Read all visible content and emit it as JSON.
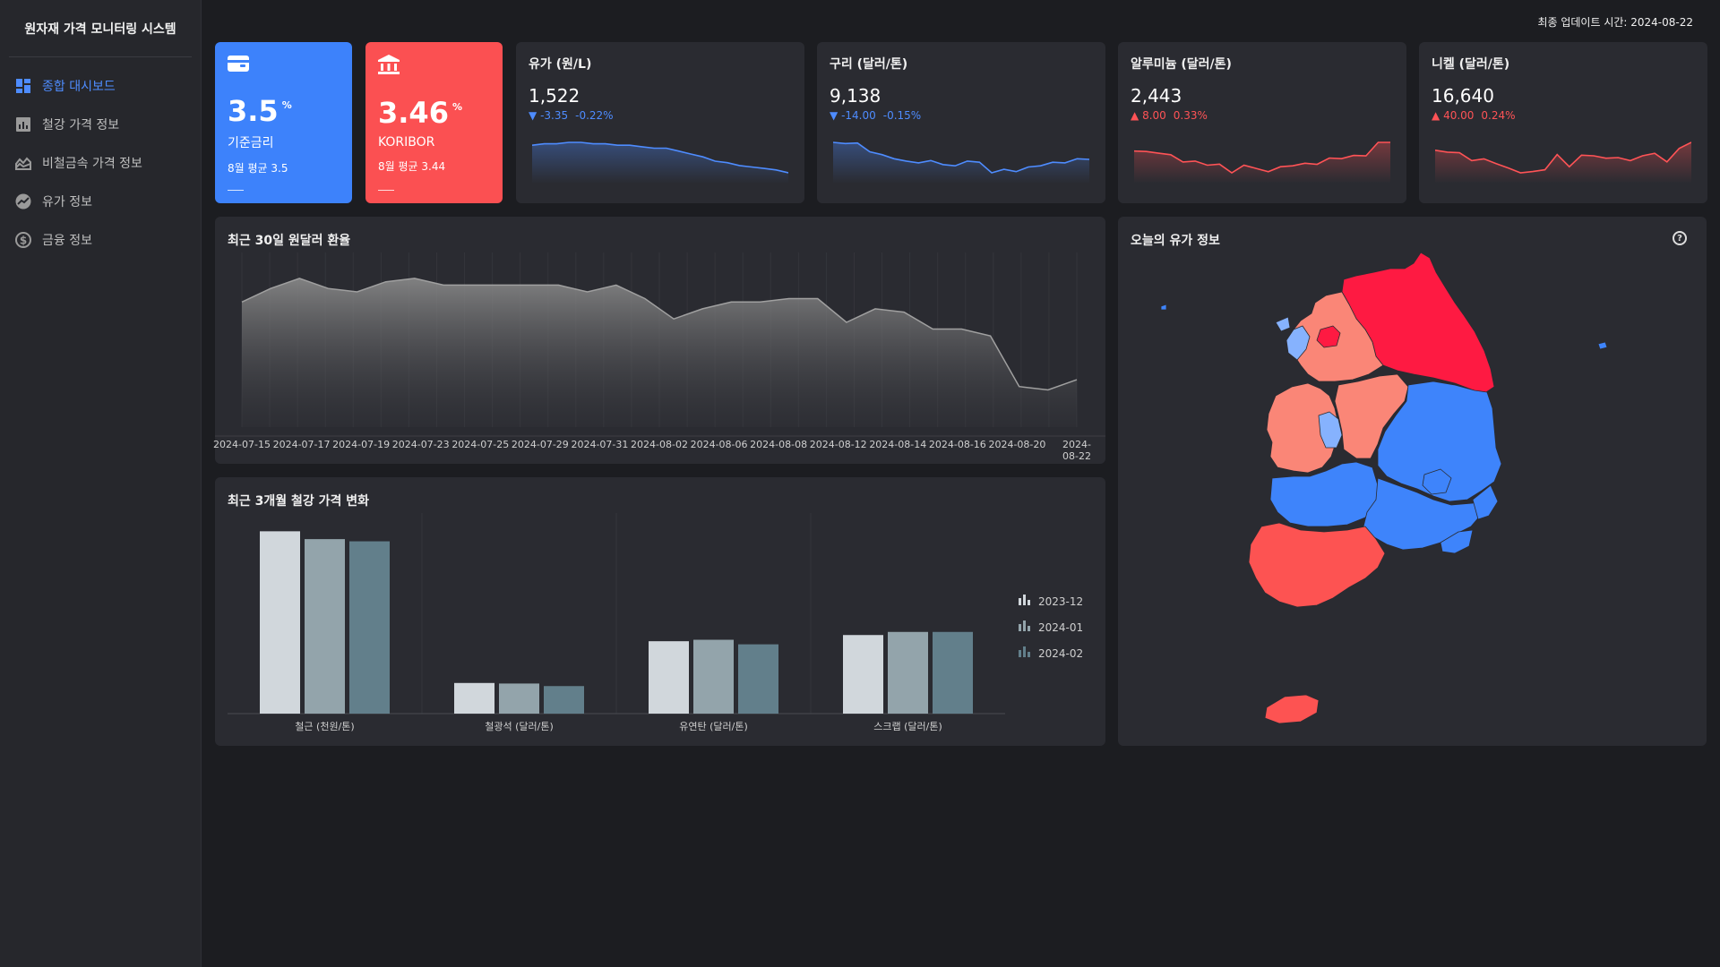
{
  "app": {
    "title": "원자재 가격 모니터링 시스템"
  },
  "sidebar": {
    "items": [
      {
        "label": "종합 대시보드",
        "icon": "dashboard-icon"
      },
      {
        "label": "철강 가격 정보",
        "icon": "bar-chart-icon"
      },
      {
        "label": "비철금속 가격 정보",
        "icon": "area-chart-icon"
      },
      {
        "label": "유가 정보",
        "icon": "trend-icon"
      },
      {
        "label": "금융 정보",
        "icon": "finance-icon"
      }
    ]
  },
  "header": {
    "updated": "최종 업데이트 시간: 2024-08-22"
  },
  "kpis": {
    "base_rate": {
      "value": "3.5",
      "unit": "%",
      "label": "기준금리",
      "avg": "8월 평균 3.5",
      "color": "#3d82fb"
    },
    "koribor": {
      "value": "3.46",
      "unit": "%",
      "label": "KORIBOR",
      "avg": "8월 평균 3.44",
      "color": "#fb5052"
    }
  },
  "minis": [
    {
      "title": "유가 (원/L)",
      "value": "1,522",
      "change": "-3.35",
      "pct": "-0.22%",
      "dir": "down",
      "series": [
        1538,
        1539,
        1539,
        1540,
        1540,
        1539,
        1539,
        1538,
        1538,
        1537,
        1536,
        1536,
        1534,
        1532,
        1530,
        1527,
        1526,
        1524,
        1523,
        1522,
        1521,
        1519
      ]
    },
    {
      "title": "구리 (달러/톤)",
      "value": "9,138",
      "change": "-14.00",
      "pct": "-0.15%",
      "dir": "down",
      "series": [
        9320,
        9310,
        9315,
        9240,
        9215,
        9180,
        9160,
        9145,
        9165,
        9130,
        9120,
        9160,
        9150,
        9060,
        9090,
        9070,
        9110,
        9120,
        9150,
        9145,
        9180,
        9175
      ]
    },
    {
      "title": "알루미늄 (달러/톤)",
      "value": "2,443",
      "change": "8.00",
      "pct": "0.33%",
      "dir": "up",
      "series": [
        2440,
        2438,
        2430,
        2423,
        2390,
        2394,
        2375,
        2380,
        2340,
        2375,
        2360,
        2345,
        2368,
        2372,
        2384,
        2379,
        2408,
        2405,
        2420,
        2418,
        2480,
        2480
      ]
    },
    {
      "title": "니켈 (달러/톤)",
      "value": "16,640",
      "change": "40.00",
      "pct": "0.24%",
      "dir": "up",
      "series": [
        16870,
        16840,
        16830,
        16700,
        16730,
        16650,
        16580,
        16500,
        16520,
        16550,
        16800,
        16600,
        16790,
        16780,
        16740,
        16750,
        16700,
        16780,
        16820,
        16680,
        16900,
        17000
      ]
    }
  ],
  "fx": {
    "title": "최근 30일 원달러 환율",
    "chart_data": {
      "type": "area",
      "x": [
        "2024-07-15",
        "2024-07-17",
        "2024-07-19",
        "2024-07-23",
        "2024-07-25",
        "2024-07-29",
        "2024-07-31",
        "2024-08-02",
        "2024-08-06",
        "2024-08-08",
        "2024-08-12",
        "2024-08-14",
        "2024-08-16",
        "2024-08-20",
        "2024-08-22"
      ],
      "values": [
        1382,
        1386,
        1389,
        1386,
        1385,
        1388,
        1389,
        1387,
        1387,
        1387,
        1387,
        1387,
        1385,
        1387,
        1383,
        1377,
        1380,
        1382,
        1382,
        1383,
        1383,
        1376,
        1380,
        1379,
        1374,
        1374,
        1372,
        1357,
        1356,
        1359
      ],
      "ylim": [
        1345,
        1394
      ],
      "grid": true
    }
  },
  "steel": {
    "title": "최근 3개월 철강 가격 변화",
    "chart_data": {
      "type": "bar",
      "categories": [
        "철근 (천원/톤)",
        "철광석 (달러/톤)",
        "유연탄 (달러/톤)",
        "스크랩 (달러/톤)"
      ],
      "series": [
        {
          "name": "2023-12",
          "values": [
            1000,
            168,
            397,
            431
          ],
          "color": "#d1d7dc"
        },
        {
          "name": "2024-01",
          "values": [
            957,
            165,
            405,
            448
          ],
          "color": "#93a4ab"
        },
        {
          "name": "2024-02",
          "values": [
            945,
            151,
            380,
            448
          ],
          "color": "#627f8b"
        }
      ],
      "ylim": [
        0,
        1100
      ],
      "legend": "right"
    }
  },
  "oilmap": {
    "title": "오늘의 유가 정보",
    "colors": {
      "high": "#fe1a42",
      "mid_high": "#fa8677",
      "mid_low": "#3e84fb",
      "low": "#86b2fe"
    }
  }
}
